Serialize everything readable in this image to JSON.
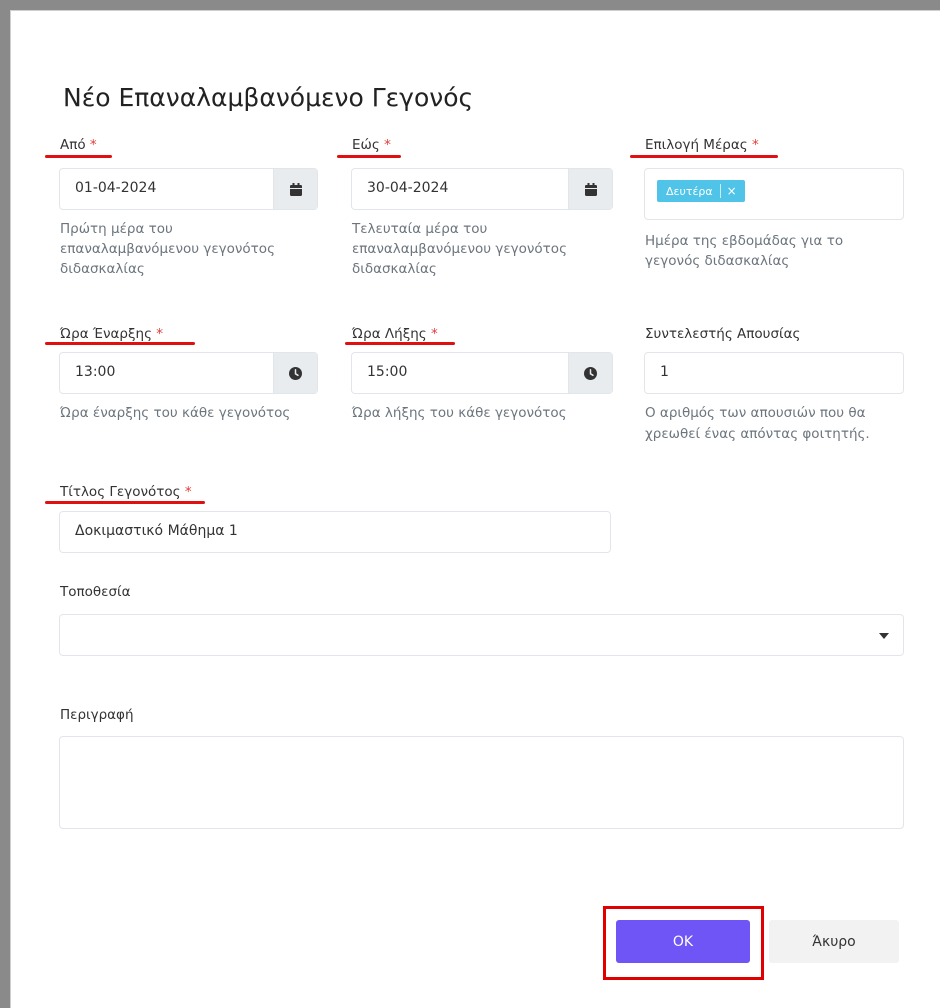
{
  "dialog": {
    "title": "Νέο Επαναλαμβανόμενο Γεγονός",
    "required_mark": "*"
  },
  "from": {
    "label": "Από",
    "value": "01-04-2024",
    "help": [
      "Πρώτη μέρα του",
      "επαναλαμβανόμενου γεγονότος",
      "διδασκαλίας"
    ],
    "icon": "calendar-icon"
  },
  "to": {
    "label": "Εώς",
    "value": "30-04-2024",
    "help": [
      "Τελευταία μέρα του",
      "επαναλαμβανόμενου γεγονότος",
      "διδασκαλίας"
    ],
    "icon": "calendar-icon"
  },
  "day": {
    "label": "Επιλογή Μέρας",
    "selected_tag": "Δευτέρα",
    "remove_glyph": "×",
    "help": [
      "Ημέρα της εβδομάδας για το",
      "γεγονός διδασκαλίας"
    ]
  },
  "start_time": {
    "label": "Ώρα Έναρξης",
    "value": "13:00",
    "help": "Ώρα έναρξης του κάθε γεγονότος",
    "icon": "clock-icon"
  },
  "end_time": {
    "label": "Ώρα Λήξης",
    "value": "15:00",
    "help": "Ώρα λήξης του κάθε γεγονότος",
    "icon": "clock-icon"
  },
  "absence": {
    "label": "Συντελεστής Απουσίας",
    "value": "1",
    "help": [
      "Ο αριθμός των απουσιών που θα",
      "χρεωθεί ένας απόντας φοιτητής."
    ]
  },
  "event_title": {
    "label": "Τίτλος Γεγονότος",
    "value": "Δοκιμαστικό Μάθημα 1"
  },
  "location": {
    "label": "Τοποθεσία",
    "value": ""
  },
  "description": {
    "label": "Περιγραφή",
    "value": ""
  },
  "actions": {
    "ok_label": "OK",
    "cancel_label": "Άκυρο"
  },
  "colors": {
    "primary": "#6f55f5",
    "tag": "#4fc3e8",
    "required": "#e53935",
    "annotation": "#e00000"
  }
}
